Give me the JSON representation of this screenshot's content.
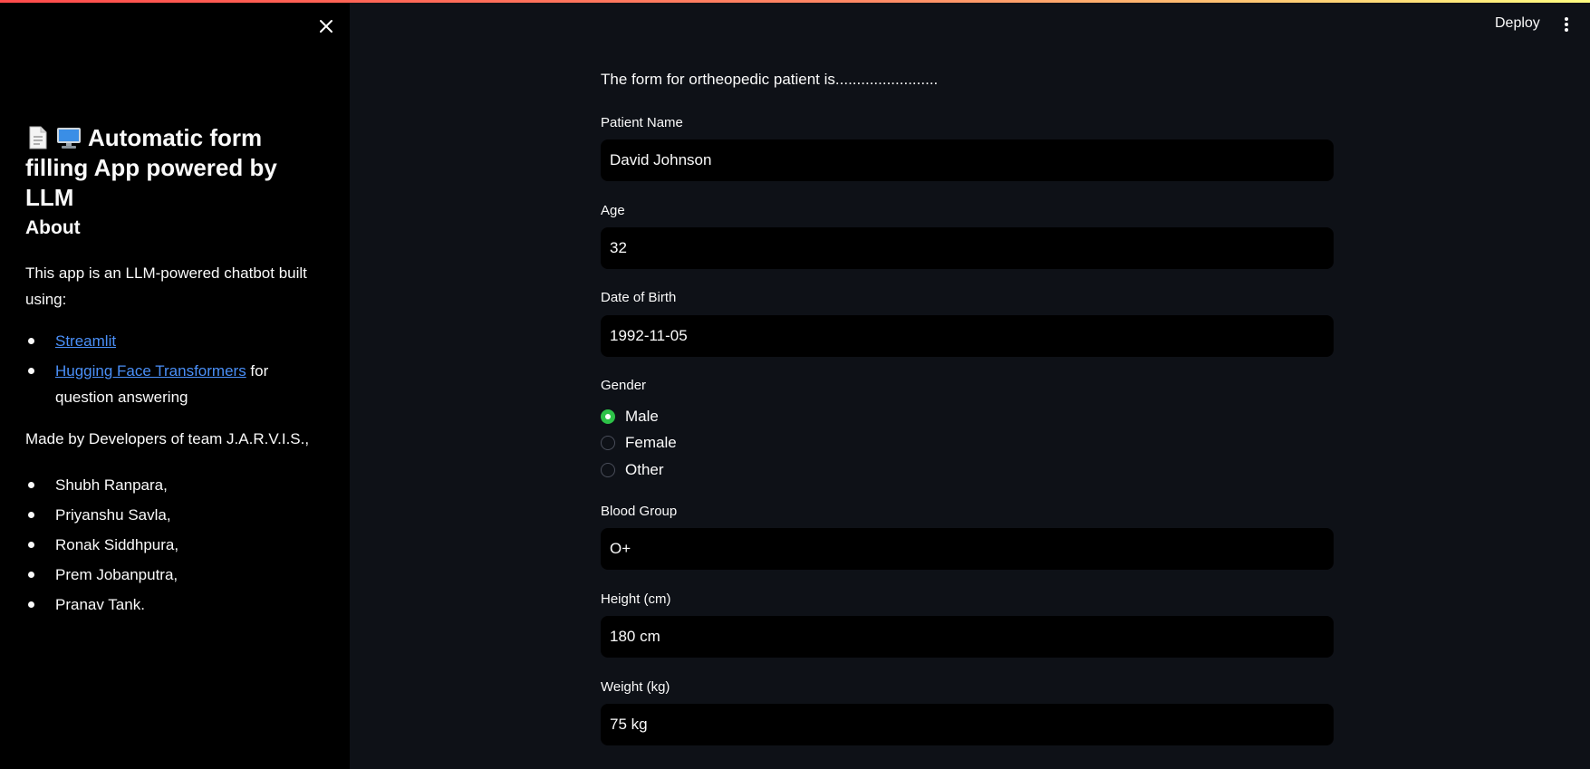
{
  "header": {
    "deploy_label": "Deploy"
  },
  "sidebar": {
    "title": "Automatic form filling App powered by LLM",
    "about_heading": "About",
    "about_text": "This app is an LLM-powered chatbot built using:",
    "tools": [
      {
        "link": "Streamlit",
        "suffix": ""
      },
      {
        "link": "Hugging Face Transformers",
        "suffix": " for question answering"
      }
    ],
    "made_by": "Made by Developers of team J.A.R.V.I.S.,",
    "developers": [
      "Shubh Ranpara,",
      "Priyanshu Savla,",
      "Ronak Siddhpura,",
      "Prem Jobanputra,",
      "Pranav Tank."
    ]
  },
  "form": {
    "intro": "The form for ortheopedic patient is........................",
    "patient_name": {
      "label": "Patient Name",
      "value": "David Johnson"
    },
    "age": {
      "label": "Age",
      "value": "32"
    },
    "dob": {
      "label": "Date of Birth",
      "value": "1992-11-05"
    },
    "gender": {
      "label": "Gender",
      "options": [
        "Male",
        "Female",
        "Other"
      ],
      "selected": "Male"
    },
    "blood_group": {
      "label": "Blood Group",
      "value": "O+"
    },
    "height": {
      "label": "Height (cm)",
      "value": "180 cm"
    },
    "weight": {
      "label": "Weight (kg)",
      "value": "75 kg"
    }
  },
  "colors": {
    "background": "#0e1117",
    "sidebar_bg": "#000000",
    "input_bg": "#000000",
    "link": "#4a8ff7",
    "radio_selected": "#2dc248"
  },
  "icons": [
    "close-icon",
    "document-icon",
    "computer-icon",
    "kebab-menu-icon"
  ]
}
